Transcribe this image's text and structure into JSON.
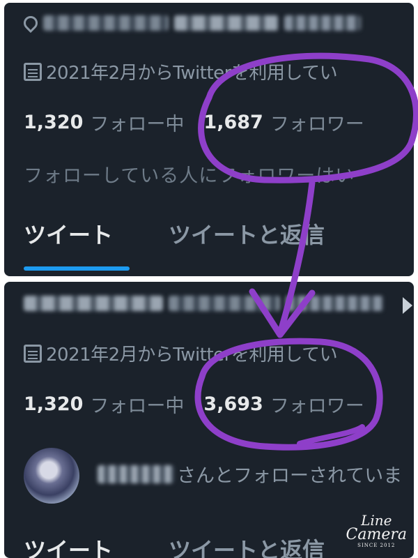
{
  "top_profile": {
    "joined": "2021年2月からTwitterを利用してい",
    "following_count": "1,320",
    "following_label": "フォロー中",
    "followers_count": "1,687",
    "followers_label": "フォロワー",
    "notice": "フォローしている人にフォロワーはい",
    "tabs": [
      "ツイート",
      "ツイートと返信"
    ],
    "active_tab": "ツイート"
  },
  "bottom_profile": {
    "joined": "2021年2月からTwitterを利用してい",
    "following_count": "1,320",
    "following_label": "フォロー中",
    "followers_count": "3,693",
    "followers_label": "フォロワー",
    "followed_by_suffix": "さんとフォローされていま",
    "tabs": [
      "ツイート",
      "ツイートと返信"
    ]
  },
  "watermark": {
    "line1": "Line",
    "line2": "Camera",
    "line3": "SINCE 2012"
  },
  "colors": {
    "panel_bg": "#1b222b",
    "annotation": "#8e3fc9",
    "tab_underline": "#1d9bf0"
  },
  "icons": [
    "location-pin-icon",
    "calendar-icon",
    "chevron-right-icon"
  ]
}
